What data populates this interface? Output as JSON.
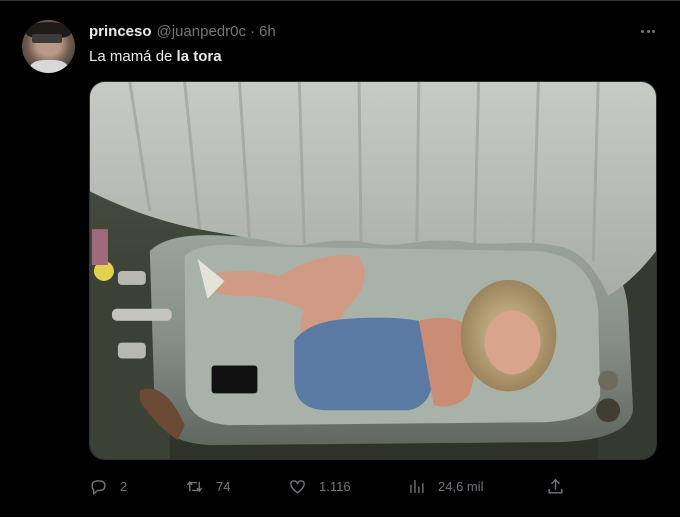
{
  "tweet": {
    "author": {
      "display_name": "princeso",
      "handle": "@juanpedr0c",
      "separator": "·",
      "time": "6h"
    },
    "text_plain": "La mamá de ",
    "text_bold": "la tora",
    "media": {
      "description_icon": "photo"
    },
    "actions": {
      "replies": "2",
      "reposts": "74",
      "likes": "1.116",
      "views": "24,6 mil"
    }
  },
  "colors": {
    "background": "#000000",
    "primary_text": "#e7e9ea",
    "secondary_text": "#71767b",
    "border": "#2f3336"
  }
}
